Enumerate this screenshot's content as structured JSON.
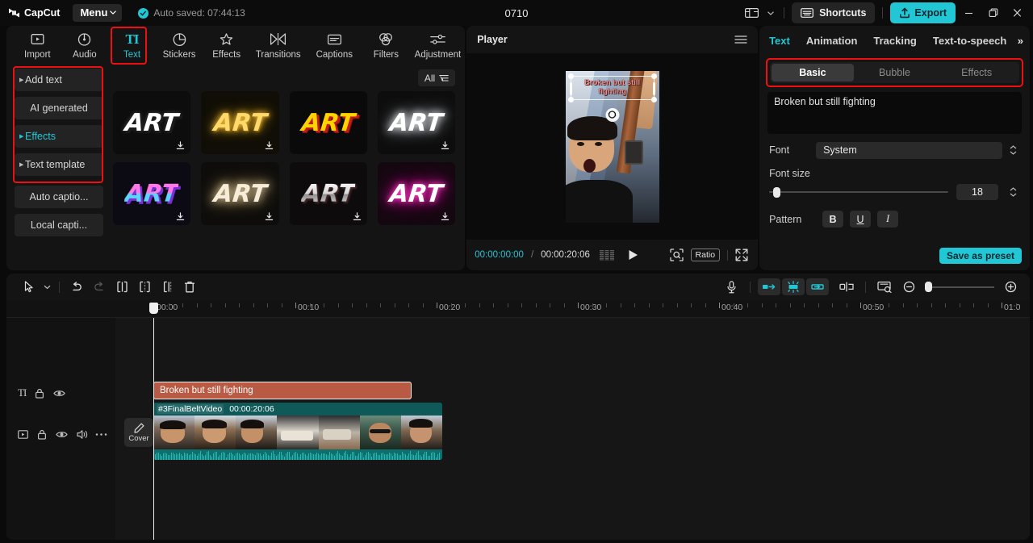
{
  "titlebar": {
    "brand": "CapCut",
    "menu_label": "Menu",
    "autosave": "Auto saved: 07:44:13",
    "project_title": "0710",
    "layout_icon": "layout-icon",
    "layout_caret_icon": "chevron-down-icon",
    "shortcuts_label": "Shortcuts",
    "shortcuts_icon": "keyboard-icon",
    "export_label": "Export",
    "export_icon": "upload-icon",
    "minimize_icon": "minimize-icon",
    "maximize_icon": "maximize-icon",
    "close_icon": "close-icon"
  },
  "nav": {
    "items": [
      {
        "label": "Import",
        "icon": "import-icon",
        "active": false
      },
      {
        "label": "Audio",
        "icon": "audio-icon",
        "active": false
      },
      {
        "label": "Text",
        "icon": "text-TI-icon",
        "active": true
      },
      {
        "label": "Stickers",
        "icon": "sticker-icon",
        "active": false
      },
      {
        "label": "Effects",
        "icon": "effects-icon",
        "active": false
      },
      {
        "label": "Transitions",
        "icon": "transitions-icon",
        "active": false
      },
      {
        "label": "Captions",
        "icon": "captions-icon",
        "active": false
      },
      {
        "label": "Filters",
        "icon": "filters-icon",
        "active": false
      },
      {
        "label": "Adjustment",
        "icon": "adjustment-icon",
        "active": false
      }
    ],
    "ti_glyph": "TI"
  },
  "sidebar": {
    "items": [
      {
        "label": "Add text",
        "arrow": true,
        "teal": false
      },
      {
        "label": "AI generated",
        "arrow": false,
        "teal": false
      },
      {
        "label": "Effects",
        "arrow": true,
        "teal": true
      },
      {
        "label": "Text template",
        "arrow": true,
        "teal": false
      },
      {
        "label": "Auto captio...",
        "arrow": false,
        "teal": false
      },
      {
        "label": "Local capti...",
        "arrow": false,
        "teal": false
      }
    ]
  },
  "gallery": {
    "filter_label": "All",
    "filter_icon": "filter-icon",
    "download_icon": "download-icon",
    "items": [
      {
        "word": "ART",
        "style": "white-shadow",
        "download": true
      },
      {
        "word": "ART",
        "style": "yellow-glow",
        "download": true
      },
      {
        "word": "ART",
        "style": "yellow-red",
        "download": false
      },
      {
        "word": "ART",
        "style": "white-glow",
        "download": true
      },
      {
        "word": "ART",
        "style": "pink-blue-3d",
        "download": true
      },
      {
        "word": "ART",
        "style": "cream-glow",
        "download": true
      },
      {
        "word": "ART",
        "style": "silver-metal",
        "download": true
      },
      {
        "word": "ART",
        "style": "magenta-neon",
        "download": true
      }
    ]
  },
  "player": {
    "title": "Player",
    "menu_icon": "hamburger-icon",
    "overlay_text": "Broken but still fighting",
    "rotate_icon": "rotate-icon",
    "current_time": "00:00:00:00",
    "separator": "/",
    "total_time": "00:00:20:06",
    "frames_icon": "frames-icon",
    "play_icon": "play-icon",
    "focus_icon": "magnify-frame-icon",
    "ratio_label": "Ratio",
    "fullscreen_icon": "fullscreen-icon"
  },
  "inspector": {
    "tabs": [
      {
        "label": "Text",
        "active": true
      },
      {
        "label": "Animation",
        "active": false
      },
      {
        "label": "Tracking",
        "active": false
      },
      {
        "label": "Text-to-speech",
        "active": false
      }
    ],
    "more_tabs_icon": "chevron-double-right-icon",
    "segments": [
      {
        "label": "Basic",
        "active": true
      },
      {
        "label": "Bubble",
        "active": false
      },
      {
        "label": "Effects",
        "active": false
      }
    ],
    "text_value": "Broken but still fighting",
    "font_label": "Font",
    "font_value": "System",
    "font_stepper_icon": "stepper-icon",
    "fontsize_label": "Font size",
    "fontsize_value": "18",
    "fontsize_stepper_icon": "stepper-icon",
    "pattern_label": "Pattern",
    "pattern_buttons": [
      {
        "label": "B",
        "name": "bold-button"
      },
      {
        "label": "U",
        "name": "underline-button"
      },
      {
        "label": "I",
        "name": "italic-button"
      }
    ],
    "save_preset_label": "Save as preset"
  },
  "timeline_toolbar": {
    "select_icon": "cursor-select-icon",
    "select_caret_icon": "chevron-down-icon",
    "undo_icon": "undo-icon",
    "redo_icon": "redo-icon",
    "split_icon": "split-icon",
    "trim_left_icon": "trim-left-icon",
    "trim_right_icon": "trim-right-icon",
    "delete_icon": "delete-icon",
    "mic_icon": "microphone-icon",
    "keyframe_prev_icon": "speed-in-icon",
    "keyframe_icon": "keyframe-icon",
    "keyframe_next_icon": "speed-out-icon",
    "mirror_icon": "mirror-icon",
    "crop_icon": "crop-preview-icon",
    "zoom_out_icon": "zoom-out-icon",
    "zoom_in_icon": "zoom-in-icon"
  },
  "ruler": {
    "labels": [
      "00:00",
      "00:10",
      "00:20",
      "00:30",
      "00:40",
      "00:50",
      "01:0"
    ]
  },
  "tracks": {
    "text_track": {
      "type_icon": "text-TI-icon",
      "lock_icon": "lock-icon",
      "eye_icon": "eye-icon",
      "clip_label": "Broken but still fighting"
    },
    "video_track": {
      "type_icon": "video-icon",
      "lock_icon": "lock-icon",
      "eye_icon": "eye-icon",
      "volume_icon": "speaker-icon",
      "more_icon": "more-dots-icon",
      "cover_label": "Cover",
      "cover_icon": "pencil-icon",
      "clip_name": "#3FinalBeltVideo",
      "clip_duration": "00:00:20:06"
    }
  },
  "colors": {
    "accent": "#22c7d6",
    "highlight": "#ee1111",
    "text_clip": "#b85a44",
    "video_clip": "#0f5a59"
  }
}
